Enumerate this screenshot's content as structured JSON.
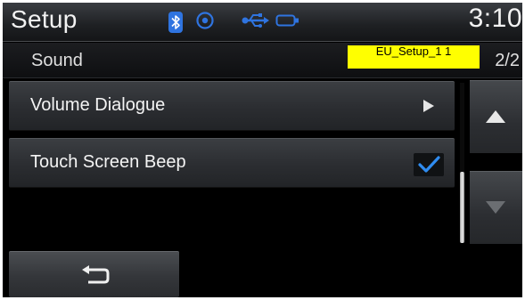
{
  "statusbar": {
    "title": "Setup",
    "clock": "3:10",
    "icons": [
      "bluetooth-icon",
      "target-icon",
      "usb-icon",
      "battery-icon"
    ],
    "colors": {
      "bluetooth": "#2f74e0"
    }
  },
  "subheader": {
    "title": "Sound",
    "tag": "EU_Setup_1 1",
    "page_indicator": "2/2"
  },
  "list": {
    "items": [
      {
        "label": "Volume Dialogue",
        "action": "arrow-right-icon"
      },
      {
        "label": "Touch Screen Beep",
        "action": "checkmark-icon",
        "checked": true
      }
    ]
  },
  "scroll": {
    "up_icon": "triangle-up-icon",
    "down_icon": "triangle-down-icon"
  },
  "footer": {
    "back_icon": "back-arrow-icon"
  },
  "accent_color": "#2f8cf0"
}
